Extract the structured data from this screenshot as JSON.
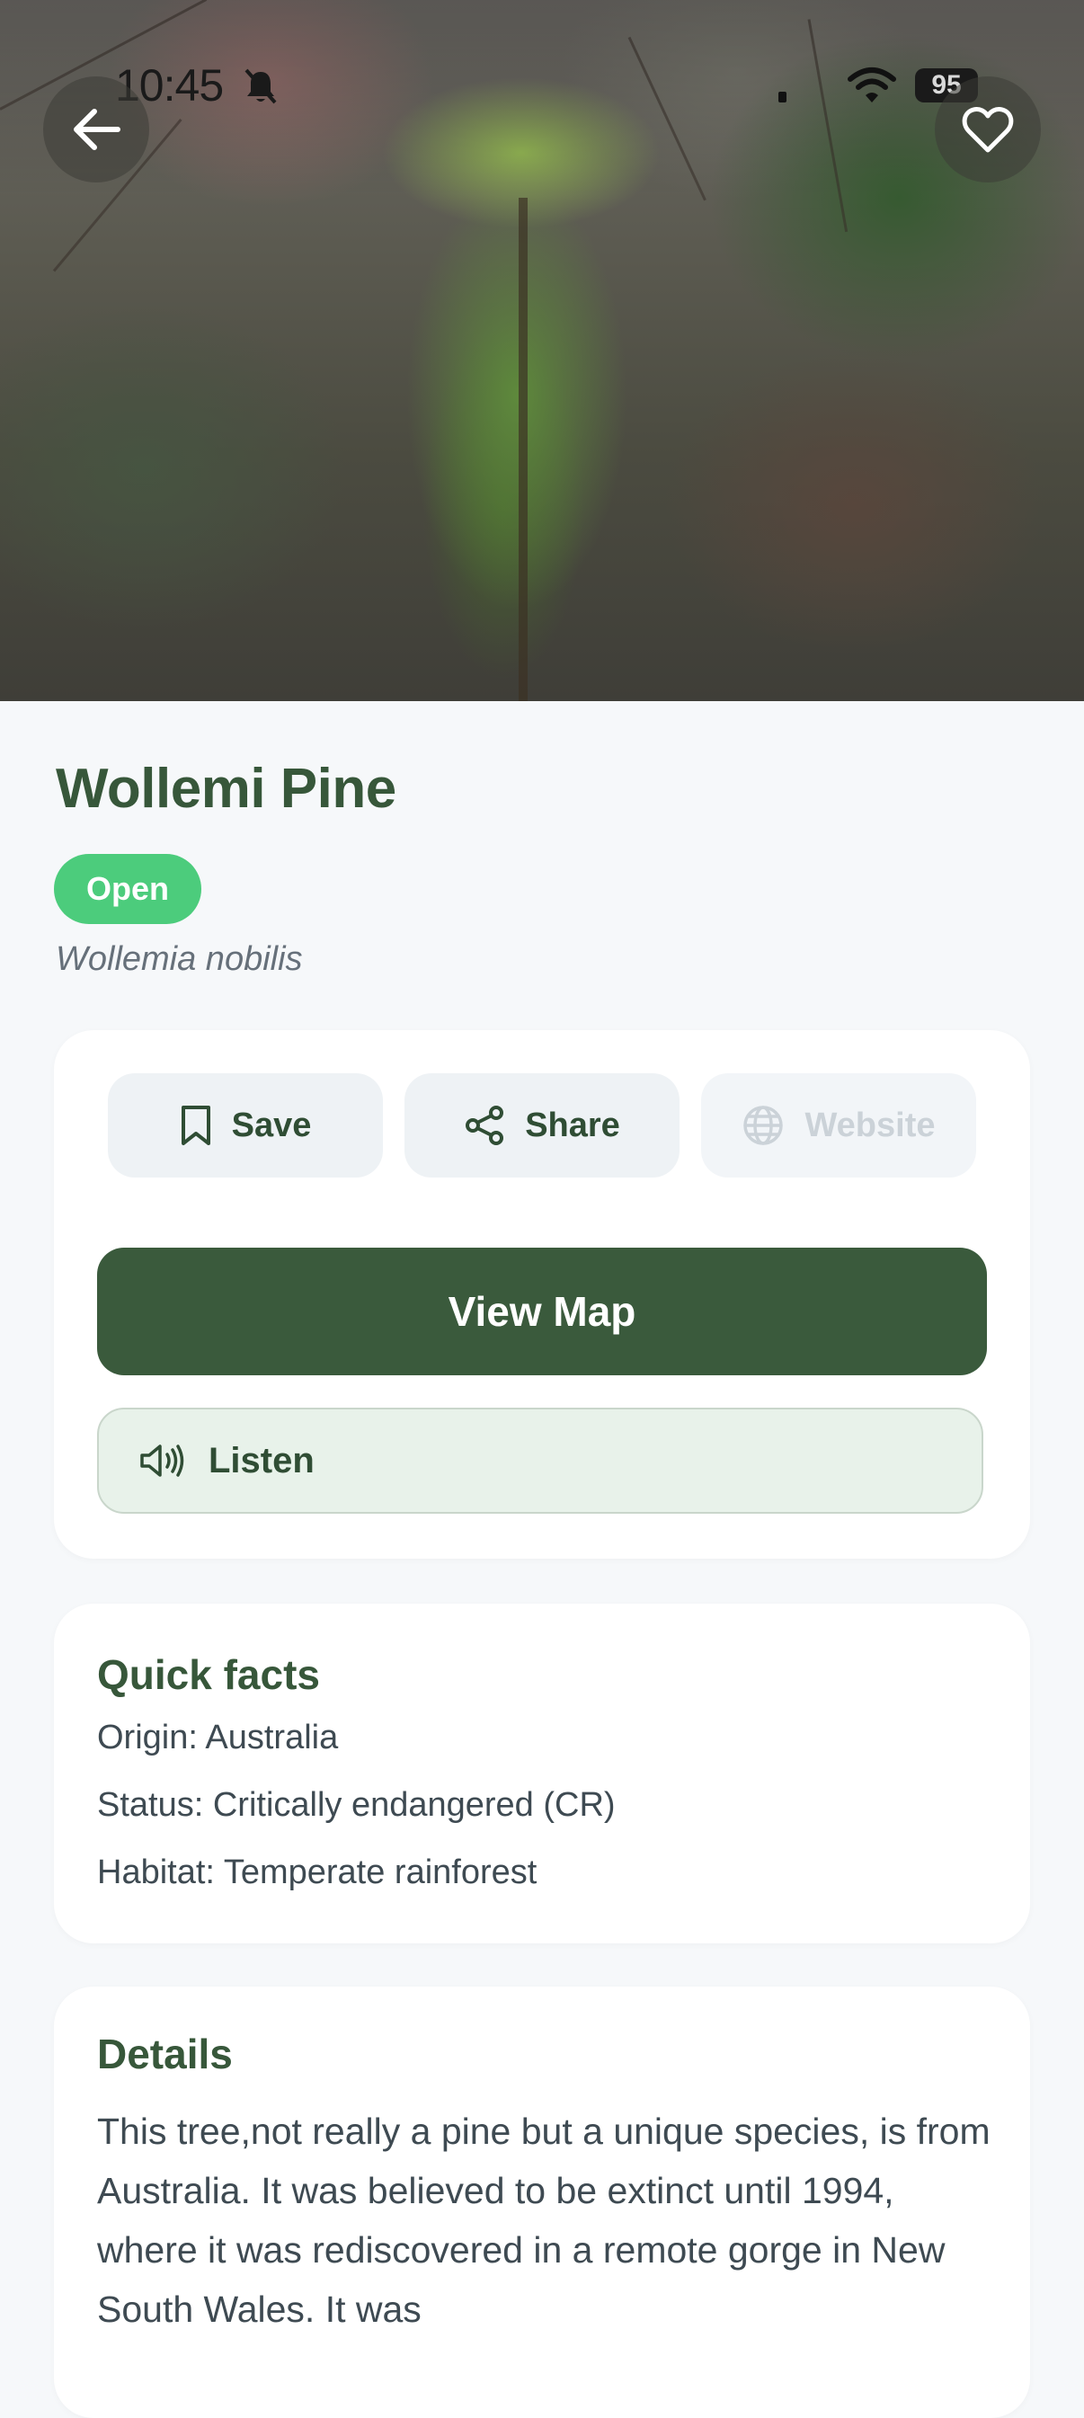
{
  "status_bar": {
    "time": "10:45",
    "battery": "95"
  },
  "hero": {
    "back_icon": "arrow-left-icon",
    "favorite_icon": "heart-icon"
  },
  "place": {
    "name": "Wollemi Pine",
    "status_badge": "Open",
    "scientific_name": "Wollemia nobilis"
  },
  "actions": {
    "save_label": "Save",
    "share_label": "Share",
    "website_label": "Website",
    "view_map_label": "View Map",
    "listen_label": "Listen"
  },
  "quick_facts": {
    "title": "Quick facts",
    "items": [
      "Origin: Australia",
      "Status: Critically endangered (CR)",
      "Habitat: Temperate rainforest"
    ]
  },
  "details": {
    "title": "Details",
    "text": "This tree,not really a pine but a unique species, is from Australia. It was believed to be extinct until 1994, where it was rediscovered in a remote gorge in New South Wales. It was"
  },
  "colors": {
    "brand_green": "#3a5a3c",
    "title_green": "#37573a",
    "open_badge": "#4ccc7c",
    "listen_bg": "#e8f2ea",
    "page_bg": "#f6f8fa"
  }
}
